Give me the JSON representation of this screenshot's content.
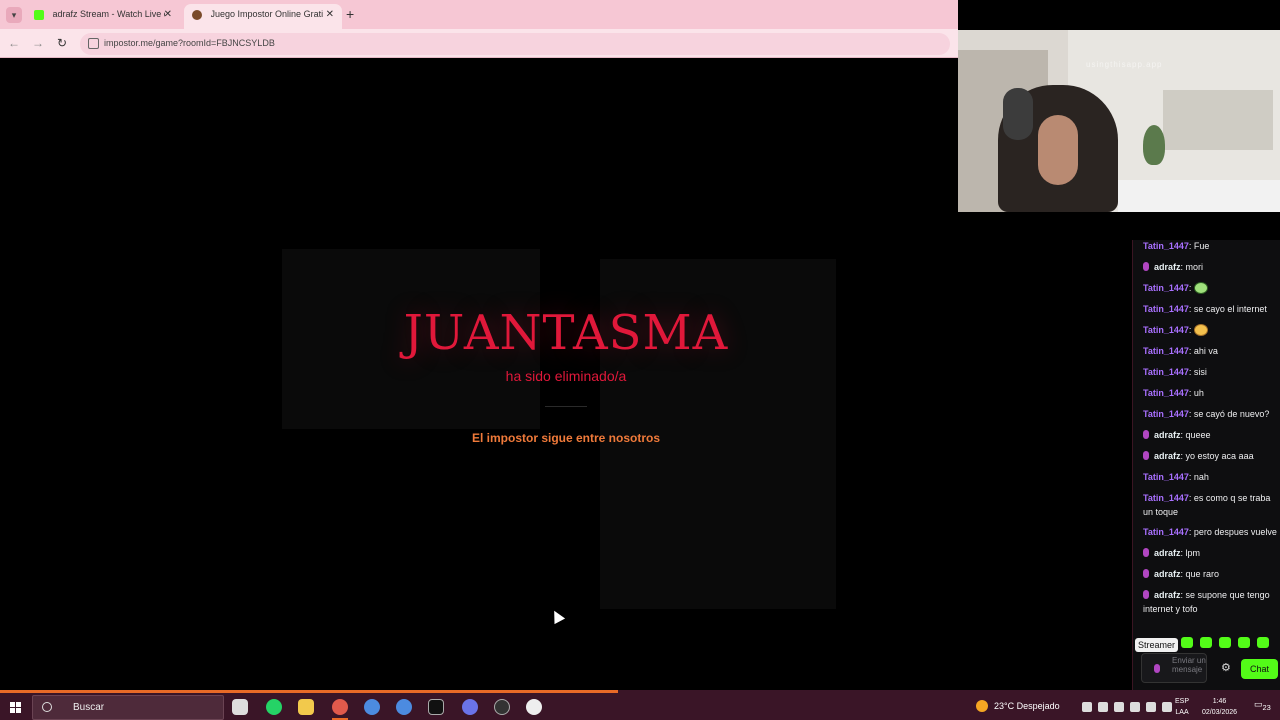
{
  "browser": {
    "tabs": [
      {
        "title": "adrafz Stream - Watch Live on Kick",
        "active": false
      },
      {
        "title": "Juego Impostor Online Gratis - Impostor.me",
        "active": true
      }
    ],
    "new_tab_icon": "plus-icon",
    "address": "impostor.me/game?roomId=FBJNCSYLDB"
  },
  "game": {
    "eliminated_name": "JUANTASMA",
    "eliminated_subtitle": "ha sido eliminado/a",
    "result_message": "El impostor sigue entre nosotros",
    "accent_color": "#e0183a",
    "message_color": "#f07a3a"
  },
  "webcam": {
    "watermark": "usingthisapp.app"
  },
  "chat": {
    "messages": [
      {
        "user": "Tatin_1447",
        "role": "viewer",
        "text": "Fue"
      },
      {
        "user": "adrafz",
        "role": "host",
        "text": "mori"
      },
      {
        "user": "Tatin_1447",
        "role": "viewer",
        "emote": "ghost"
      },
      {
        "user": "Tatin_1447",
        "role": "viewer",
        "text": "se cayo el internet"
      },
      {
        "user": "Tatin_1447",
        "role": "viewer",
        "emote": "face"
      },
      {
        "user": "Tatin_1447",
        "role": "viewer",
        "text": "ahi va"
      },
      {
        "user": "Tatin_1447",
        "role": "viewer",
        "text": "sisi"
      },
      {
        "user": "Tatin_1447",
        "role": "viewer",
        "text": "uh"
      },
      {
        "user": "Tatin_1447",
        "role": "viewer",
        "text": "se cayó de nuevo?"
      },
      {
        "user": "adrafz",
        "role": "host",
        "text": "queee"
      },
      {
        "user": "adrafz",
        "role": "host",
        "text": "yo estoy aca aaa"
      },
      {
        "user": "Tatin_1447",
        "role": "viewer",
        "text": "nah"
      },
      {
        "user": "Tatin_1447",
        "role": "viewer",
        "text": "es como q se traba un toque"
      },
      {
        "user": "Tatin_1447",
        "role": "viewer",
        "text": "pero despues vuelve"
      },
      {
        "user": "adrafz",
        "role": "host",
        "text": "lpm"
      },
      {
        "user": "adrafz",
        "role": "host",
        "text": "que raro"
      },
      {
        "user": "adrafz",
        "role": "host",
        "text": "se supone que tengo internet y tofo"
      }
    ],
    "streamer_badge": "Streamer",
    "input_placeholder": "Enviar un mensaje",
    "send_button": "Chat",
    "accent_color": "#53fc18"
  },
  "taskbar": {
    "search_label": "Buscar",
    "weather": "23°C Despejado",
    "language": [
      "ESP",
      "LAA"
    ],
    "time": "1:46",
    "date": "02/03/2026",
    "notifications": "23"
  }
}
